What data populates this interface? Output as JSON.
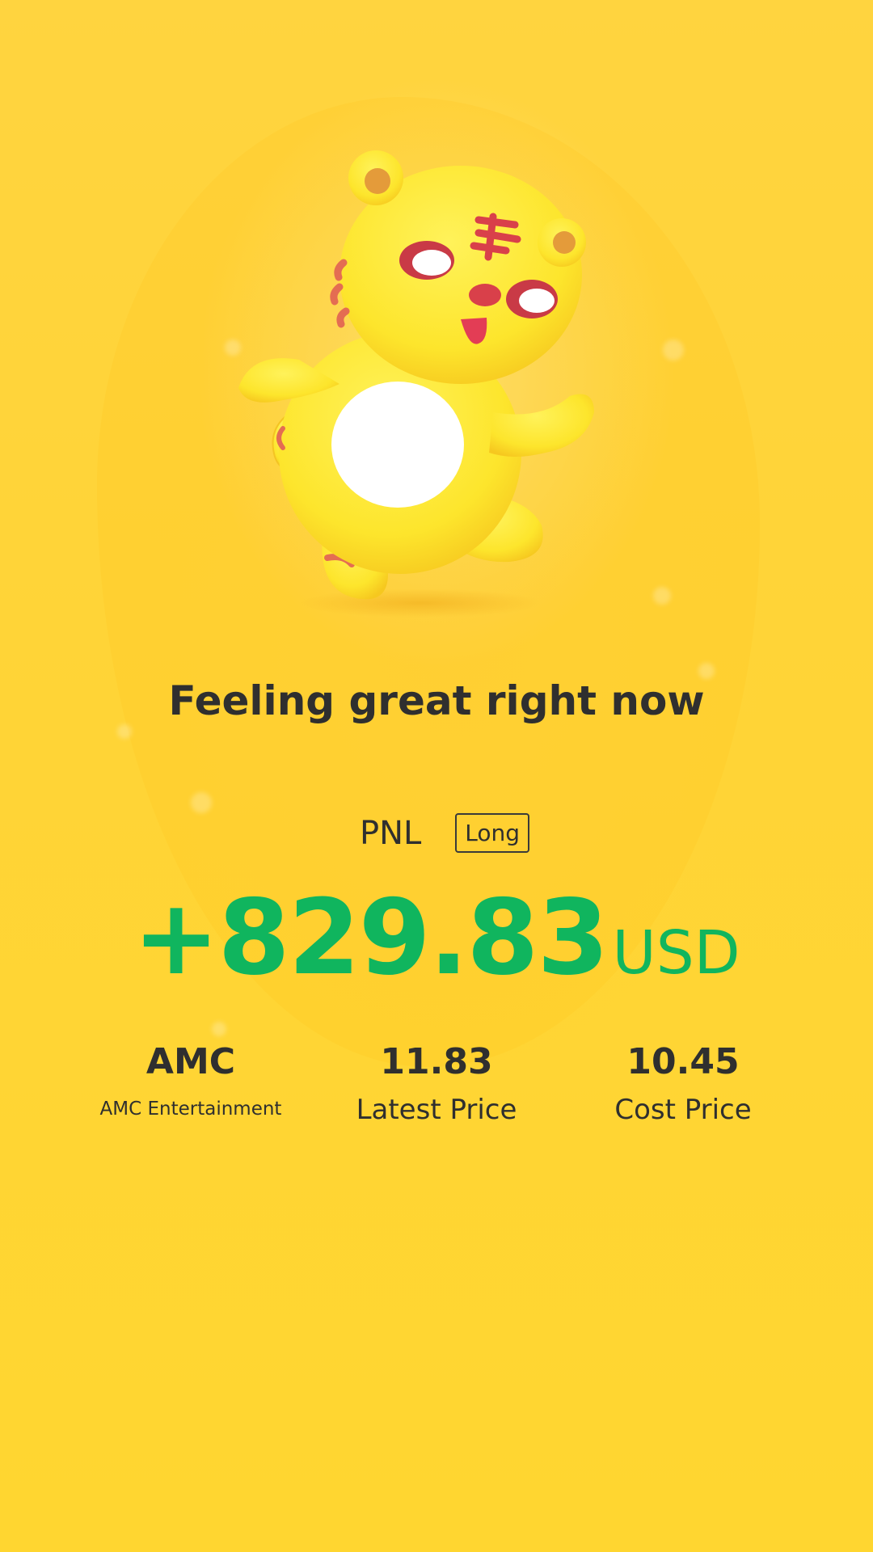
{
  "headline": "Feeling great right now",
  "pnl": {
    "label": "PNL",
    "side": "Long",
    "amount": "+829.83",
    "currency": "USD"
  },
  "stats": [
    {
      "value": "AMC",
      "label": "AMC Entertainment"
    },
    {
      "value": "11.83",
      "label": "Latest Price"
    },
    {
      "value": "10.45",
      "label": "Cost Price"
    }
  ],
  "colors": {
    "background": "#ffd43f",
    "profit": "#10b55e",
    "text": "#2f2f2f",
    "mascot_body": "#fde52c",
    "mascot_accent": "#d9404a"
  },
  "mascot": {
    "icon": "tiger-mascot-icon"
  }
}
